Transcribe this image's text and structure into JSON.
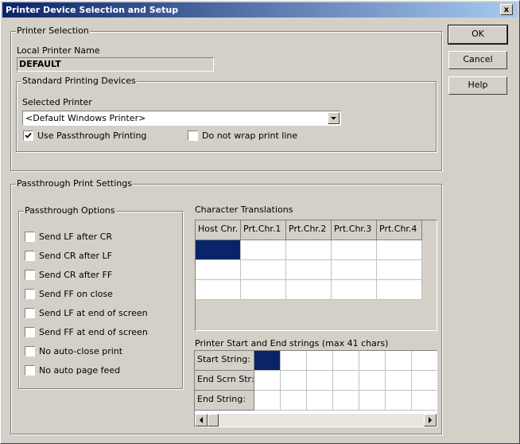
{
  "window": {
    "title": "Printer Device Selection and Setup",
    "close_glyph": "x"
  },
  "buttons": {
    "ok": "OK",
    "cancel": "Cancel",
    "help": "Help"
  },
  "printer_selection": {
    "legend": "Printer Selection",
    "local_name_label": "Local Printer Name",
    "local_name_value": "DEFAULT",
    "standard_devices": {
      "legend": "Standard Printing Devices",
      "selected_label": "Selected Printer",
      "selected_value": "<Default Windows Printer>",
      "use_passthrough": {
        "label": "Use Passthrough Printing",
        "checked": true
      },
      "no_wrap": {
        "label": "Do not wrap print line",
        "checked": false
      }
    }
  },
  "passthrough_settings": {
    "legend": "Passthrough Print Settings",
    "options_legend": "Passthrough Options",
    "options": [
      {
        "label": "Send LF after CR",
        "checked": false
      },
      {
        "label": "Send CR after LF",
        "checked": false
      },
      {
        "label": "Send CR after FF",
        "checked": false
      },
      {
        "label": "Send FF on close",
        "checked": false
      },
      {
        "label": "Send LF at end of screen",
        "checked": false
      },
      {
        "label": "Send FF at end of screen",
        "checked": false
      },
      {
        "label": "No auto-close print",
        "checked": false
      },
      {
        "label": "No auto page feed",
        "checked": false
      }
    ],
    "char_translations": {
      "label": "Character Translations",
      "columns": [
        "Host Chr.",
        "Prt.Chr.1",
        "Prt.Chr.2",
        "Prt.Chr.3",
        "Prt.Chr.4"
      ],
      "rows": 3
    },
    "start_end": {
      "label": "Printer Start and End strings (max 41 chars)",
      "row_labels": [
        "Start String:",
        "End Scrn Str:",
        "End String:"
      ]
    }
  },
  "colors": {
    "face": "#d4d0c8",
    "title_gradient_start": "#0a246a",
    "title_gradient_end": "#a6caf0",
    "selection": "#0a246a"
  }
}
